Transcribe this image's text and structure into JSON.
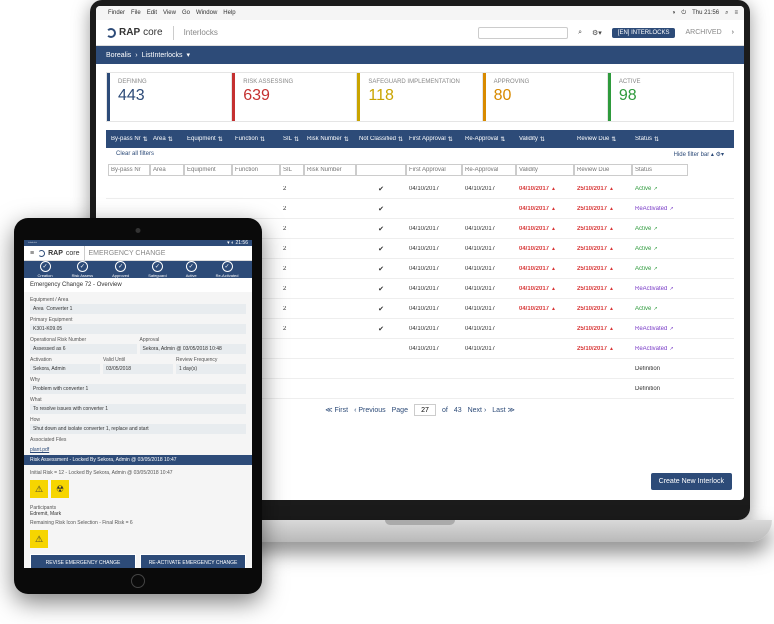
{
  "menubar": {
    "apple": "",
    "items": [
      "Finder",
      "File",
      "Edit",
      "View",
      "Go",
      "Window",
      "Help"
    ],
    "clock": "Thu 21:56"
  },
  "app": {
    "brand1": "RAP",
    "brand2": "core",
    "section": "Interlocks",
    "tab_active": "[EN] INTERLOCKS",
    "tab_archived": "ARCHIVED"
  },
  "breadcrumb": {
    "a": "Borealis",
    "b": "ListInterlocks"
  },
  "stats": [
    {
      "label": "DEFINING",
      "value": "443",
      "color": "#2d4b78"
    },
    {
      "label": "RISK ASSESSING",
      "value": "639",
      "color": "#c43030"
    },
    {
      "label": "SAFEGUARD IMPLEMENTATION",
      "value": "118",
      "color": "#c9a400"
    },
    {
      "label": "APPROVING",
      "value": "80",
      "color": "#d88a00"
    },
    {
      "label": "ACTIVE",
      "value": "98",
      "color": "#2e9a3c"
    }
  ],
  "columns": [
    "By-pass Nr",
    "Area",
    "Equipment",
    "Function",
    "SIL",
    "Risk Number",
    "Not Classified",
    "First Approval",
    "Re-Approval",
    "Validity",
    "Review Due",
    "Status"
  ],
  "clear_filters": "Clear all filters",
  "hide_filter": "Hide filter bar",
  "rows": [
    {
      "sil": "2",
      "fa": "04/10/2017",
      "ra": "04/10/2017",
      "va": "04/10/2017",
      "rd": "25/10/2017",
      "st": "Active",
      "cls": "grn"
    },
    {
      "sil": "2",
      "fa": "",
      "ra": "",
      "va": "04/10/2017",
      "rd": "25/10/2017",
      "st": "ReActivated",
      "cls": "ppl"
    },
    {
      "sil": "2",
      "fa": "04/10/2017",
      "ra": "04/10/2017",
      "va": "04/10/2017",
      "rd": "25/10/2017",
      "st": "Active",
      "cls": "grn"
    },
    {
      "sil": "2",
      "fa": "04/10/2017",
      "ra": "04/10/2017",
      "va": "04/10/2017",
      "rd": "25/10/2017",
      "st": "Active",
      "cls": "grn"
    },
    {
      "sil": "2",
      "fa": "04/10/2017",
      "ra": "04/10/2017",
      "va": "04/10/2017",
      "rd": "25/10/2017",
      "st": "Active",
      "cls": "grn"
    },
    {
      "sil": "2",
      "fa": "04/10/2017",
      "ra": "04/10/2017",
      "va": "04/10/2017",
      "rd": "25/10/2017",
      "st": "ReActivated",
      "cls": "ppl"
    },
    {
      "sil": "2",
      "fa": "04/10/2017",
      "ra": "04/10/2017",
      "va": "04/10/2017",
      "rd": "25/10/2017",
      "st": "Active",
      "cls": "grn"
    },
    {
      "sil": "2",
      "fa": "04/10/2017",
      "ra": "04/10/2017",
      "va": "",
      "rd": "25/10/2017",
      "st": "ReActivated",
      "cls": "ppl"
    },
    {
      "sil": "",
      "fa": "04/10/2017",
      "ra": "04/10/2017",
      "va": "",
      "rd": "25/10/2017",
      "st": "ReActivated",
      "cls": "ppl"
    },
    {
      "sil": "",
      "fa": "",
      "ra": "",
      "va": "",
      "rd": "",
      "st": "Definition",
      "cls": ""
    },
    {
      "sil": "",
      "fa": "",
      "ra": "",
      "va": "",
      "rd": "",
      "st": "Definition",
      "cls": ""
    }
  ],
  "pager": {
    "first": "≪ First",
    "prev": "‹ Previous",
    "page_lbl": "Page",
    "page": "27",
    "of": "of",
    "total": "43",
    "next": "Next ›",
    "last": "Last ≫"
  },
  "create_btn": "Create New Interlock",
  "tablet": {
    "status_l": "◦◦◦◦◦",
    "status_r": "▾ ◐ 21:56",
    "menu": "≡",
    "section": "EMERGENCY CHANGE",
    "steps": [
      "Creation",
      "Risk Assess",
      "Approved",
      "Safeguard",
      "Active",
      "Re-Activated"
    ],
    "title": "Emergency Change 72 - Overview",
    "eq_area_lbl": "Equipment / Area",
    "eq_area_a": "Area",
    "eq_area_b": "Converter 1",
    "prim_lbl": "Primary Equipment",
    "prim_v": "K301-K09.05",
    "orn_lbl": "Operational Risk Number",
    "orn_v": "Assessed as 6",
    "app_lbl": "Approval",
    "app_v": "Sekora, Admin @ 03/05/2018 10:48",
    "act_lbl": "Activation",
    "act_v": "Sekora, Admin",
    "vu_lbl": "Valid Until",
    "vu_v": "03/05/2018",
    "rf_lbl": "Review Frequency",
    "rf_v": "1 day(s)",
    "why_lbl": "Why",
    "why_v": "Problem with converter 1",
    "what_lbl": "What",
    "what_v": "To resolve issues with converter 1",
    "how_lbl": "How",
    "how_v": "Shut down and isolate converter 1, replace and start",
    "assoc_lbl": "Associated Files",
    "assoc_v": "plant.pdf",
    "ra_hdr": "Risk Assessment - Locked By Sekora, Admin @ 03/05/2018 10:47",
    "irisk": "Initial Risk = 12 - Locked By Sekora, Admin @ 03/05/2018 10:47",
    "part_lbl": "Participants",
    "part_v": "Edremit, Mark",
    "remain": "Remaining Risk Icon Selection - Final Risk = 6",
    "btn_revise": "REVISE EMERGENCY CHANGE",
    "btn_react": "RE-ACTIVATE EMERGENCY CHANGE"
  }
}
